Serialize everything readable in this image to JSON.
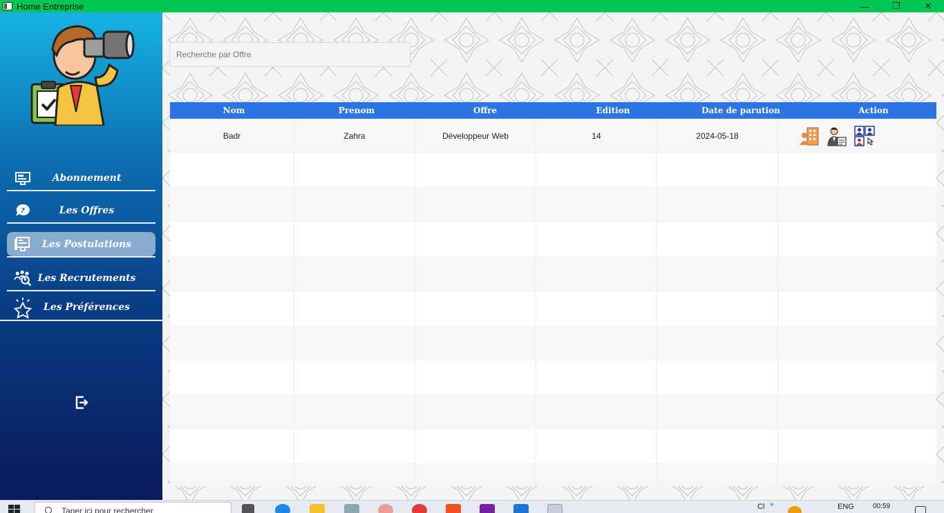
{
  "window": {
    "title": "Home Entreprise",
    "controls": [
      "—",
      "❐",
      "✕"
    ]
  },
  "sidebar": {
    "items": [
      {
        "label": "Abonnement",
        "icon": "subscription-icon"
      },
      {
        "label": "Les Offres",
        "icon": "question-bubble-icon"
      },
      {
        "label": "Les Postulations",
        "icon": "applications-icon",
        "active": true
      },
      {
        "label": "Les Recrutements",
        "icon": "recruitment-icon"
      },
      {
        "label": "Les Préférences",
        "icon": "star-icon"
      }
    ],
    "logout_icon": "logout-icon"
  },
  "search": {
    "placeholder": "Recherche par Offre",
    "value": ""
  },
  "table": {
    "columns": [
      "Nom",
      "Prenom",
      "Offre",
      "Edition",
      "Date de parution",
      "Action"
    ],
    "rows": [
      {
        "nom": "Badr",
        "prenom": "Zahra",
        "offre": "Développeur Web",
        "edition": "14",
        "date": "2024-05-18",
        "actions": [
          "building-person-icon",
          "person-document-icon",
          "profiles-grid-icon"
        ]
      }
    ],
    "empty_rows": 10
  },
  "taskbar": {
    "search_text": "Taper ici pour rechercher",
    "tray_text_1": "Cl",
    "tray_lang": "ENG",
    "clock": "00:59",
    "tray_arrow": "»"
  },
  "colors": {
    "titlebar": "#00c853",
    "sidebar_top": "#16b3e3",
    "sidebar_bottom": "#0a1a5c",
    "header": "#2b74e2"
  }
}
